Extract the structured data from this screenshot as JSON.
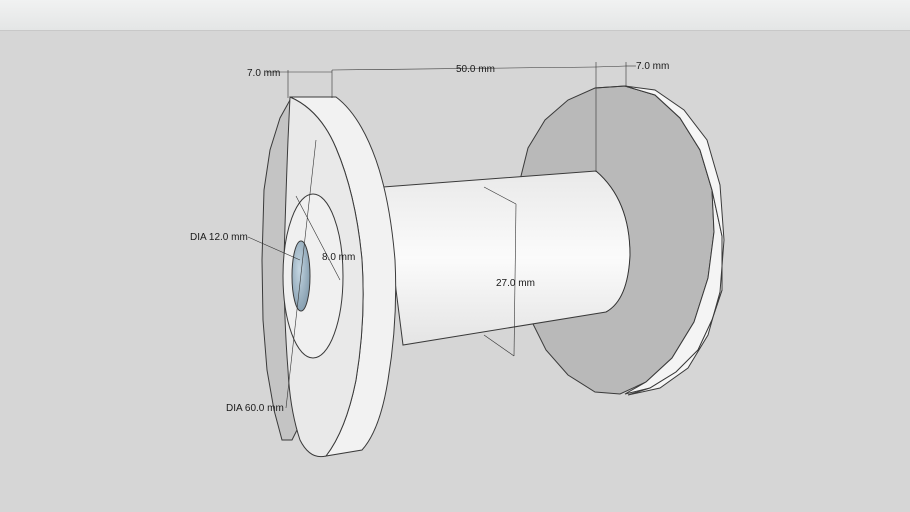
{
  "dimensions": {
    "flange_left_width": "7.0 mm",
    "spacing": "50.0 mm",
    "flange_right_width": "7.0 mm",
    "hole_diameter": "DIA 12.0 mm",
    "inner_step": "8.0 mm",
    "core_height": "27.0 mm",
    "flange_diameter": "DIA 60.0 mm"
  },
  "colors": {
    "background": "#d6d6d6",
    "face_light": "#f3f3f3",
    "face_shaded": "#b9b9b9",
    "hole": "#9fb5c4"
  }
}
